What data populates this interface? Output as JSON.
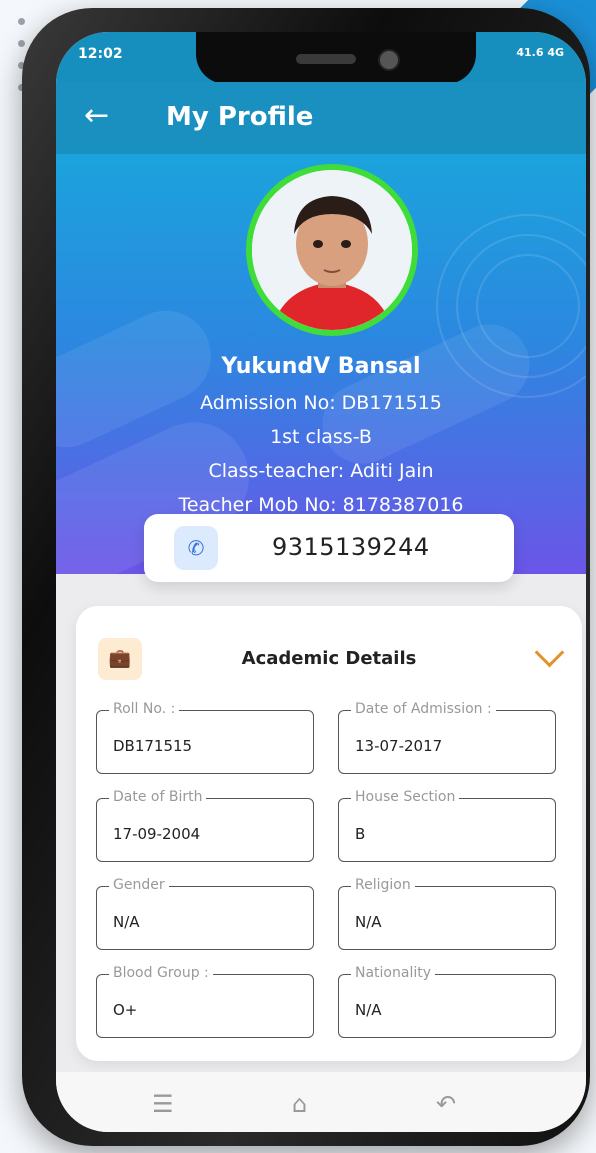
{
  "status": {
    "time": "12:02",
    "right": "41.6 4G"
  },
  "appbar": {
    "title": "My Profile"
  },
  "profile": {
    "name": "YukundV Bansal",
    "admission": "Admission No: DB171515",
    "class": "1st class-B",
    "class_teacher": "Class-teacher: Aditi Jain",
    "teacher_mob": "Teacher Mob No: 8178387016",
    "phone": "9315139244"
  },
  "academic": {
    "title": "Academic Details",
    "fields": [
      {
        "label": "Roll No. :",
        "value": "DB171515"
      },
      {
        "label": "Date of Admission :",
        "value": "13-07-2017"
      },
      {
        "label": "Date of Birth",
        "value": "17-09-2004"
      },
      {
        "label": "House Section",
        "value": "B"
      },
      {
        "label": "Gender",
        "value": "N/A"
      },
      {
        "label": "Religion",
        "value": "N/A"
      },
      {
        "label": "Blood Group :",
        "value": "O+"
      },
      {
        "label": "Nationality",
        "value": "N/A"
      }
    ]
  },
  "icons": {
    "back": "arrow-left-icon",
    "phone": "phone-icon",
    "briefcase": "briefcase-icon",
    "chevron": "chevron-down-icon",
    "nav": [
      "menu-icon",
      "home-icon",
      "back-nav-icon"
    ]
  },
  "colors": {
    "header": "#1a90c0",
    "hero_top": "#1ba3dc",
    "hero_bottom": "#6b55e8",
    "avatar_ring": "#3fdc3a",
    "accent_orange": "#e3912a"
  }
}
